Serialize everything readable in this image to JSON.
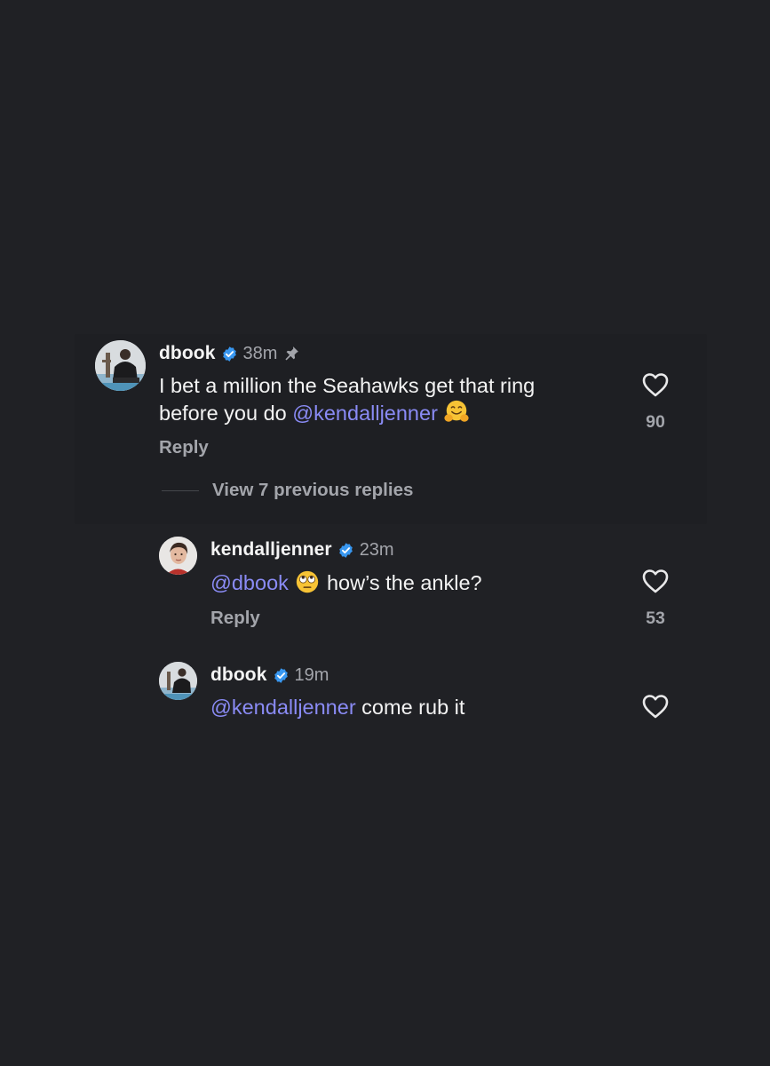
{
  "colors": {
    "background": "#202125",
    "mention": "#8a8bf5",
    "verified": "#3897f0",
    "muted": "#a3a5ab"
  },
  "main_comment": {
    "username": "dbook",
    "time": "38m",
    "pinned": true,
    "text_line1": "I bet a million the Seahawks get that ring",
    "text_line2_prefix": "before you do ",
    "mention": "@kendalljenner",
    "emoji": "hugging-face",
    "reply_label": "Reply",
    "likes": "90"
  },
  "view_previous": {
    "label": "View 7 previous replies"
  },
  "replies": [
    {
      "username": "kendalljenner",
      "time": "23m",
      "mention": "@dbook",
      "emoji": "rolling-eyes-face",
      "text": "how’s the ankle?",
      "reply_label": "Reply",
      "likes": "53"
    },
    {
      "username": "dbook",
      "time": "19m",
      "mention": "@kendalljenner",
      "text": " come rub it"
    }
  ]
}
